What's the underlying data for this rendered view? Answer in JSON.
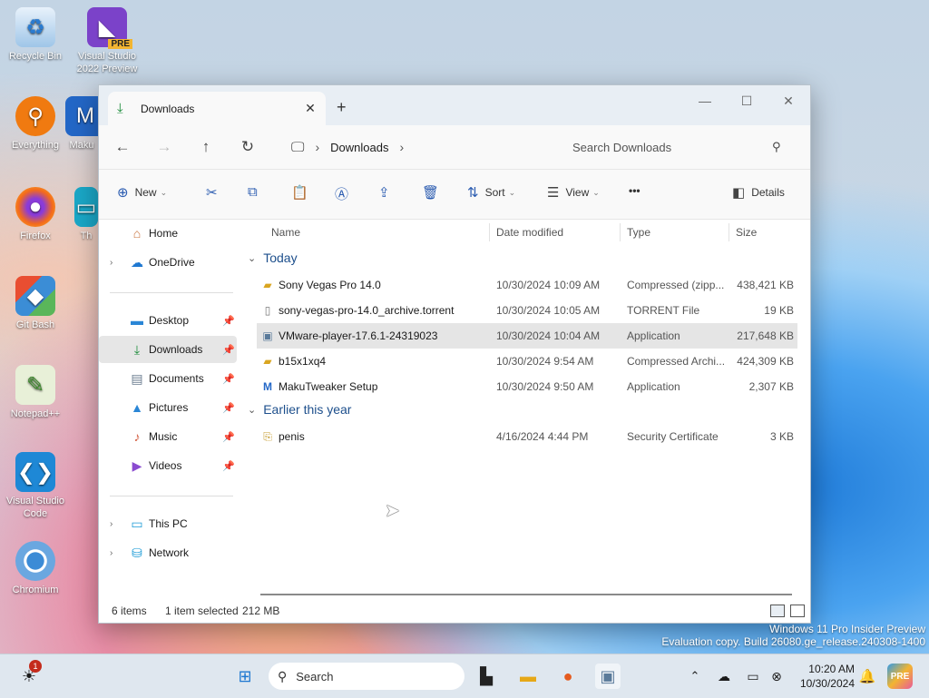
{
  "desktop": {
    "icons": [
      {
        "label": "Recycle Bin",
        "icon": "recycle-bin-icon"
      },
      {
        "label": "Visual Studio 2022 Preview",
        "icon": "visual-studio-icon",
        "badge": "PRE"
      },
      {
        "label": "Everything",
        "icon": "search-magnifier-icon"
      },
      {
        "label": "Maku",
        "icon": "makutweaker-icon"
      },
      {
        "label": "Firefox",
        "icon": "firefox-icon"
      },
      {
        "label": "Th",
        "icon": "folder-icon"
      },
      {
        "label": "Git Bash",
        "icon": "git-bash-icon"
      },
      {
        "label": "Notepad++",
        "icon": "notepadpp-icon"
      },
      {
        "label": "Visual Studio Code",
        "icon": "vscode-icon"
      },
      {
        "label": "Chromium",
        "icon": "chromium-icon"
      }
    ]
  },
  "window": {
    "tab_title": "Downloads",
    "address": {
      "root_icon": "this-pc-icon",
      "crumb": "Downloads"
    },
    "search_placeholder": "Search Downloads",
    "toolbar": {
      "new_label": "New",
      "sort_label": "Sort",
      "view_label": "View",
      "more_label": "•••",
      "details_label": "Details"
    },
    "sidebar": {
      "home": "Home",
      "onedrive": "OneDrive",
      "desktop": "Desktop",
      "downloads": "Downloads",
      "documents": "Documents",
      "pictures": "Pictures",
      "music": "Music",
      "videos": "Videos",
      "thispc": "This PC",
      "network": "Network"
    },
    "columns": {
      "name": "Name",
      "date": "Date modified",
      "type": "Type",
      "size": "Size"
    },
    "groups": {
      "today": "Today",
      "earlier": "Earlier this year"
    },
    "files_today": [
      {
        "name": "Sony Vegas Pro 14.0",
        "date": "10/30/2024 10:09 AM",
        "type": "Compressed (zipp...",
        "size": "438,421 KB",
        "icon": "zip-folder-icon"
      },
      {
        "name": "sony-vegas-pro-14.0_archive.torrent",
        "date": "10/30/2024 10:05 AM",
        "type": "TORRENT File",
        "size": "19 KB",
        "icon": "file-icon"
      },
      {
        "name": "VMware-player-17.6.1-24319023",
        "date": "10/30/2024 10:04 AM",
        "type": "Application",
        "size": "217,648 KB",
        "icon": "installer-icon",
        "selected": true
      },
      {
        "name": "b15x1xq4",
        "date": "10/30/2024 9:54 AM",
        "type": "Compressed Archi...",
        "size": "424,309 KB",
        "icon": "zip-folder-icon"
      },
      {
        "name": "MakuTweaker Setup",
        "date": "10/30/2024 9:50 AM",
        "type": "Application",
        "size": "2,307 KB",
        "icon": "makutweaker-icon"
      }
    ],
    "files_earlier": [
      {
        "name": "penis",
        "date": "4/16/2024 4:44 PM",
        "type": "Security Certificate",
        "size": "3 KB",
        "icon": "certificate-icon"
      }
    ],
    "status": {
      "count": "6 items",
      "selected": "1 item selected",
      "size": "212 MB"
    }
  },
  "watermark": {
    "line1": "Windows 11 Pro Insider Preview",
    "line2": "Evaluation copy. Build 26080.ge_release.240308-1400"
  },
  "taskbar": {
    "search_label": "Search",
    "notification_badge": "1",
    "time": "10:20 AM",
    "date": "10/30/2024"
  },
  "colors": {
    "accent": "#0067c0",
    "selection": "#e5e5e5",
    "group_header": "#1d4f8c"
  }
}
